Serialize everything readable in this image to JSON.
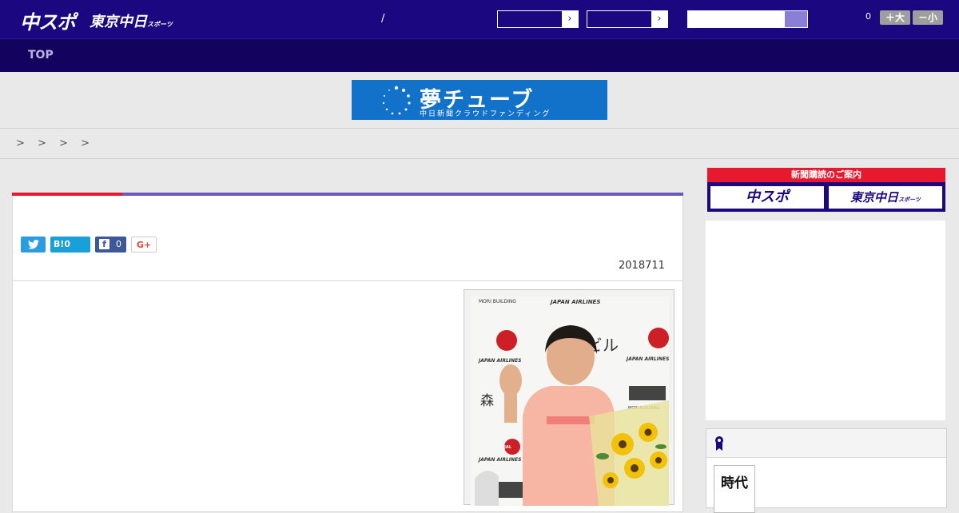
{
  "header": {
    "logo_main": "中スポ",
    "logo_tokyo": "東京中日",
    "logo_tokyo_sub": "スポーツ",
    "slash": "/",
    "select_arrow": "›",
    "font_size_count": "0",
    "font_bigger_label": "＋大",
    "font_smaller_label": "－小",
    "brand_color": "#1b0880"
  },
  "nav": {
    "top_label": "TOP"
  },
  "banner": {
    "title": "夢チューブ",
    "subtitle": "中日新聞クラウドファンディング"
  },
  "breadcrumb": {
    "text": "> > > >"
  },
  "article": {
    "share": {
      "hatena_label": "B!",
      "hatena_count": "0",
      "facebook_count": "0",
      "gplus_label": "G+"
    },
    "date": "2018711",
    "accent_red": "#e8192f",
    "accent_purple": "#6a58c0"
  },
  "photo": {
    "sign_mori": "MORI BUILDING",
    "sign_jal": "JAPAN AIRLINES",
    "sign_jal_logo": "JAL",
    "sign_biru": "ビル",
    "sign_mori_kanji": "森"
  },
  "sidebar": {
    "subscription_header": "新聞購読のご案内",
    "subscription_chuspo": "中スポ",
    "subscription_tokyo": "東京中日",
    "subscription_tokyo_sub": "スポーツ",
    "thumb_text": "時代"
  }
}
